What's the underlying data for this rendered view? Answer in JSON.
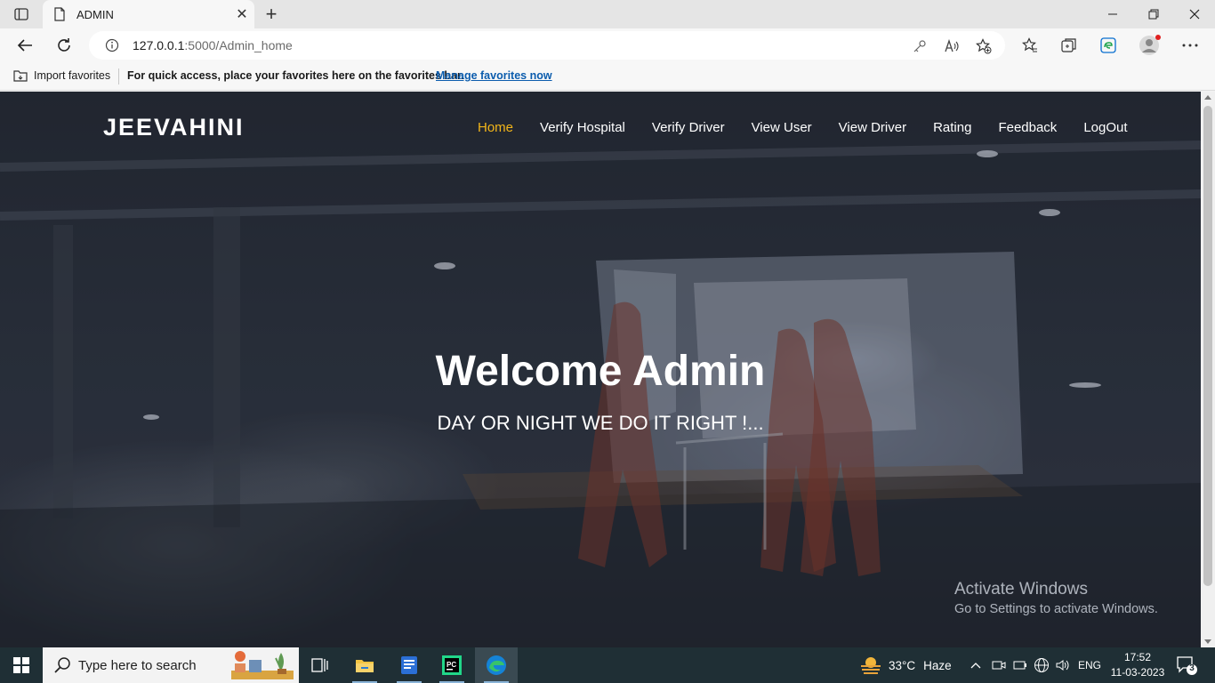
{
  "browser": {
    "tab_title": "ADMIN",
    "url_host": "127.0.0.1",
    "url_path": ":5000/Admin_home",
    "favorites": {
      "import_label": "Import favorites",
      "hint": "For quick access, place your favorites here on the favorites bar.",
      "manage_link": "Manage favorites now"
    },
    "icons": [
      "tab-actions-icon",
      "page-icon",
      "close-icon",
      "plus-icon",
      "minimize-icon",
      "restore-icon",
      "window-close-icon",
      "back-icon",
      "refresh-icon",
      "info-icon",
      "key-icon",
      "read-aloud-icon",
      "add-favorite-icon",
      "favorites-icon",
      "collections-icon",
      "edge-bar-icon",
      "profile-icon",
      "more-icon",
      "import-favorites-icon"
    ]
  },
  "site": {
    "brand": "JEEVAHINI",
    "nav": [
      {
        "label": "Home",
        "active": true
      },
      {
        "label": "Verify Hospital",
        "active": false
      },
      {
        "label": "Verify Driver",
        "active": false
      },
      {
        "label": "View User",
        "active": false
      },
      {
        "label": "View Driver",
        "active": false
      },
      {
        "label": "Rating",
        "active": false
      },
      {
        "label": "Feedback",
        "active": false
      },
      {
        "label": "LogOut",
        "active": false
      }
    ],
    "hero_title": "Welcome Admin",
    "hero_subtitle": "DAY OR NIGHT WE DO IT RIGHT !...",
    "accent_color": "#f2b51a"
  },
  "watermark": {
    "line1": "Activate Windows",
    "line2": "Go to Settings to activate Windows."
  },
  "taskbar": {
    "search_placeholder": "Type here to search",
    "weather_temp": "33°C",
    "weather_text": "Haze",
    "language": "ENG",
    "time": "17:52",
    "date": "11-03-2023",
    "notification_count": "3",
    "apps": [
      "task-view-icon",
      "file-explorer-icon",
      "word-pad-icon",
      "pycharm-icon",
      "edge-icon"
    ]
  }
}
